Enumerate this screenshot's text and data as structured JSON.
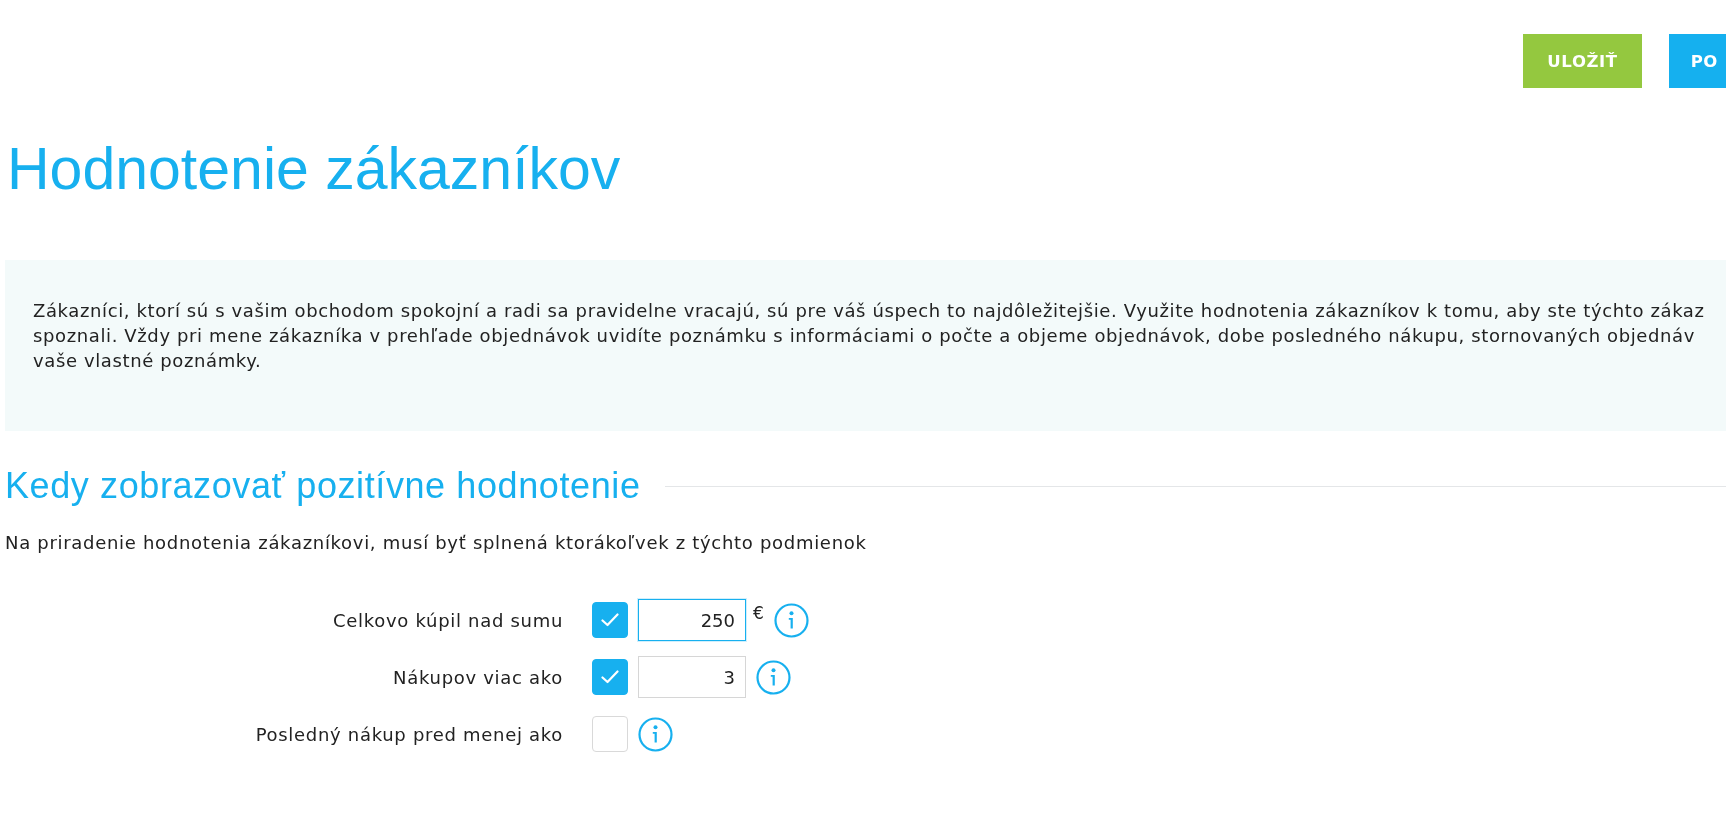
{
  "toolbar": {
    "buttons": [
      {
        "label": "ULOŽIŤ",
        "kind": "save"
      },
      {
        "label": "PO",
        "kind": "primary"
      }
    ]
  },
  "page_title": "Hodnotenie zákazníkov",
  "info_box": {
    "lines": [
      "Zákazníci, ktorí sú s vašim obchodom spokojní a radi sa pravidelne vracajú, sú pre váš úspech to najdôležitejšie. Využite hodnotenia zákazníkov k tomu, aby ste týchto zákaz",
      "spoznali. Vždy pri mene zákazníka v prehľade objednávok uvidíte poznámku s informáciami o počte a objeme objednávok, dobe posledného nákupu, stornovaných objednáv",
      "vaše vlastné poznámky."
    ]
  },
  "section": {
    "heading": "Kedy zobrazovať pozitívne hodnotenie",
    "description": "Na priradenie hodnotenia zákazníkovi, musí byť splnená ktorákoľvek z týchto podmienok",
    "conditions": [
      {
        "label": "Celkovo kúpil nad sumu",
        "checked": true,
        "input": {
          "value": "250",
          "focused": true
        },
        "unit": "€"
      },
      {
        "label": "Nákupov viac ako",
        "checked": true,
        "input": {
          "value": "3",
          "focused": false
        }
      },
      {
        "label": "Posledný nákup pred menej ako",
        "checked": false
      }
    ]
  }
}
